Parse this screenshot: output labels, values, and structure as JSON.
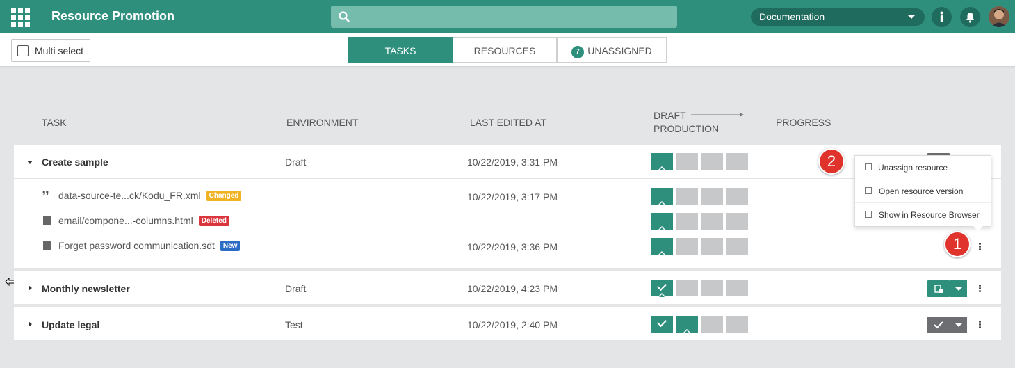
{
  "header": {
    "app_title": "Resource Promotion",
    "search_placeholder": "",
    "environment_select": "Documentation"
  },
  "toolbar": {
    "multi_select_label": "Multi select",
    "tabs": [
      {
        "label": "TASKS",
        "active": true
      },
      {
        "label": "RESOURCES",
        "active": false
      },
      {
        "label": "UNASSIGNED",
        "count": "7",
        "active": false
      }
    ]
  },
  "columns": {
    "task": "TASK",
    "environment": "ENVIRONMENT",
    "last_edited": "LAST EDITED AT",
    "draft": "DRAFT",
    "production": "PRODUCTION",
    "progress": "PROGRESS"
  },
  "tasks": [
    {
      "name": "Create sample",
      "environment": "Draft",
      "last_edited": "10/22/2019, 3:31 PM",
      "resources": [
        {
          "name": "data-source-te...ck/Kodu_FR.xml",
          "badge": "Changed",
          "last_edited": "10/22/2019, 3:17 PM"
        },
        {
          "name": "email/compone...-columns.html",
          "badge": "Deleted",
          "last_edited": ""
        },
        {
          "name": "Forget password communication.sdt",
          "badge": "New",
          "last_edited": "10/22/2019, 3:36 PM"
        }
      ]
    },
    {
      "name": "Monthly newsletter",
      "environment": "Draft",
      "last_edited": "10/22/2019, 4:23 PM"
    },
    {
      "name": "Update legal",
      "environment": "Test",
      "last_edited": "10/22/2019, 2:40 PM"
    }
  ],
  "context_menu": {
    "items": [
      "Unassign resource",
      "Open resource version",
      "Show in Resource Browser"
    ]
  },
  "callouts": {
    "one": "1",
    "two": "2"
  },
  "colors": {
    "primary": "#2e8f7d",
    "changed": "#f0b323",
    "deleted": "#d9363e",
    "new": "#2b6cc4"
  }
}
